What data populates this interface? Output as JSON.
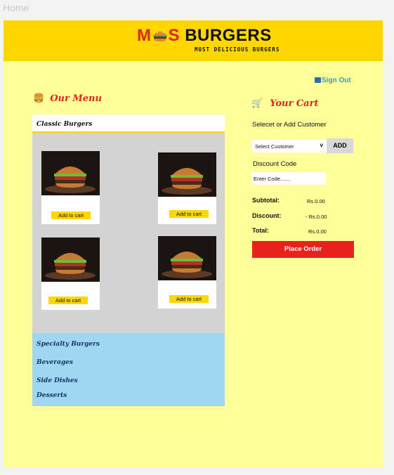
{
  "window": {
    "title": "Home"
  },
  "header": {
    "logo_prefix": "M",
    "logo_burger_icon": "burger-icon",
    "logo_suffix": "S",
    "logo_word": "BURGERS",
    "tagline": "MOST DELICIOUS BURGERS",
    "colors": {
      "header_bg": "#ffd700",
      "page_bg": "#ffff99",
      "accent": "#d6281f"
    }
  },
  "signout": {
    "label": "Sign Out",
    "icon": "sign-out-icon"
  },
  "menu": {
    "heading": "Our Menu",
    "heading_icon": "🍔",
    "active_category": "Classic Burgers",
    "items": [
      {
        "button": "Add to cart"
      },
      {
        "button": "Add to cart"
      },
      {
        "button": "Add to cart"
      },
      {
        "button": "Add to cart"
      }
    ],
    "other_categories": [
      "Specialty Burgers",
      "Beverages",
      "Side Dishes",
      "Desserts"
    ]
  },
  "cart": {
    "heading": "Your Cart",
    "heading_icon": "🛒",
    "customer_label": "Selecet or Add Customer",
    "customer_select": "Select Customer",
    "add_button": "ADD",
    "discount_label": "Discount Code",
    "discount_placeholder": "Enter Code.......",
    "subtotal_label": "Subtotal:",
    "subtotal_value": "Rs.0.00",
    "discount_total_label": "Discount:",
    "discount_value": "- Rs.0.00",
    "total_label": "Total:",
    "total_value": "Rs.0.00",
    "place_order": "Place Order"
  }
}
